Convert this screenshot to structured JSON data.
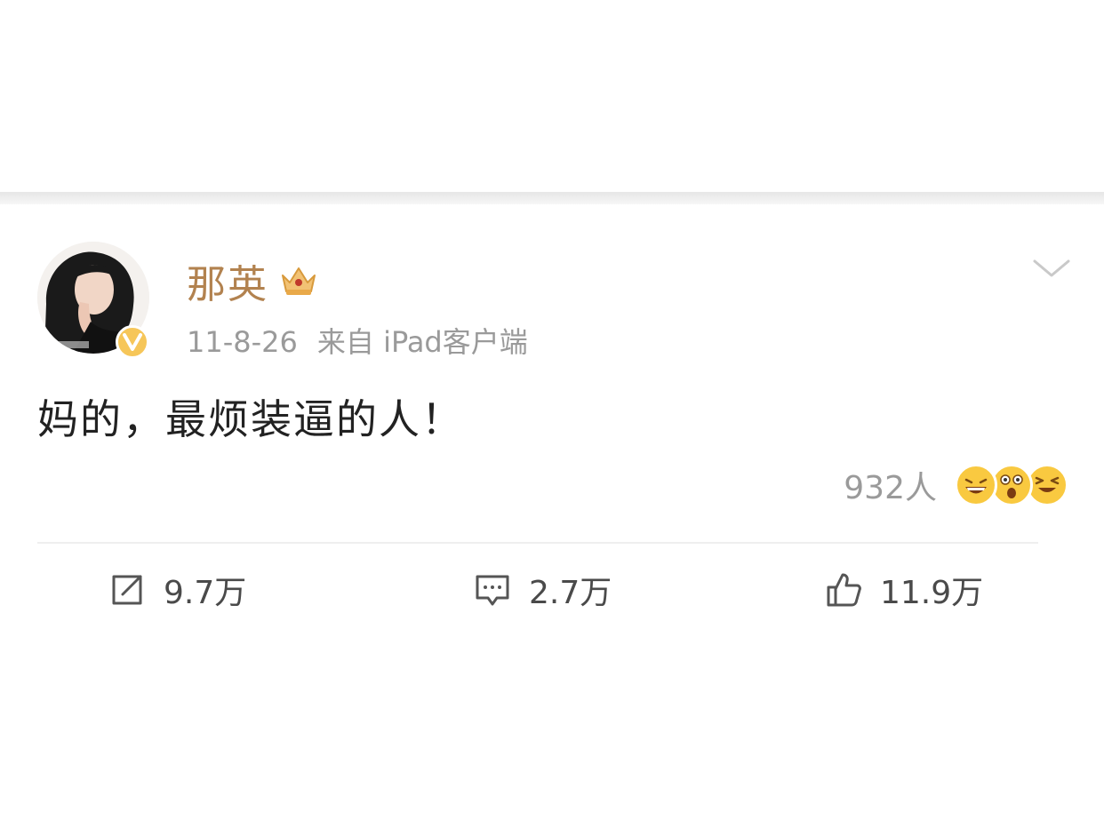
{
  "post": {
    "author": {
      "name": "那英",
      "avatar_icon": "avatar-photo",
      "verified_icon": "verified-v-icon",
      "rank_icon": "crown-icon"
    },
    "date": "11-8-26",
    "source": "来自 iPad客户端",
    "text": "妈的，最烦装逼的人！",
    "reactions": {
      "count_label": "932人",
      "icons": [
        "laughing-emoji-icon",
        "shocked-emoji-icon",
        "grinning-squint-emoji-icon"
      ]
    }
  },
  "actions": {
    "repost": {
      "icon": "repost-icon",
      "label": "9.7万"
    },
    "comment": {
      "icon": "comment-icon",
      "label": "2.7万"
    },
    "like": {
      "icon": "thumbs-up-icon",
      "label": "11.9万"
    }
  },
  "colors": {
    "username": "#b2824f",
    "meta": "#9a9a9a",
    "text": "#222222",
    "verified": "#f6c659",
    "emoji": "#f9c940"
  }
}
